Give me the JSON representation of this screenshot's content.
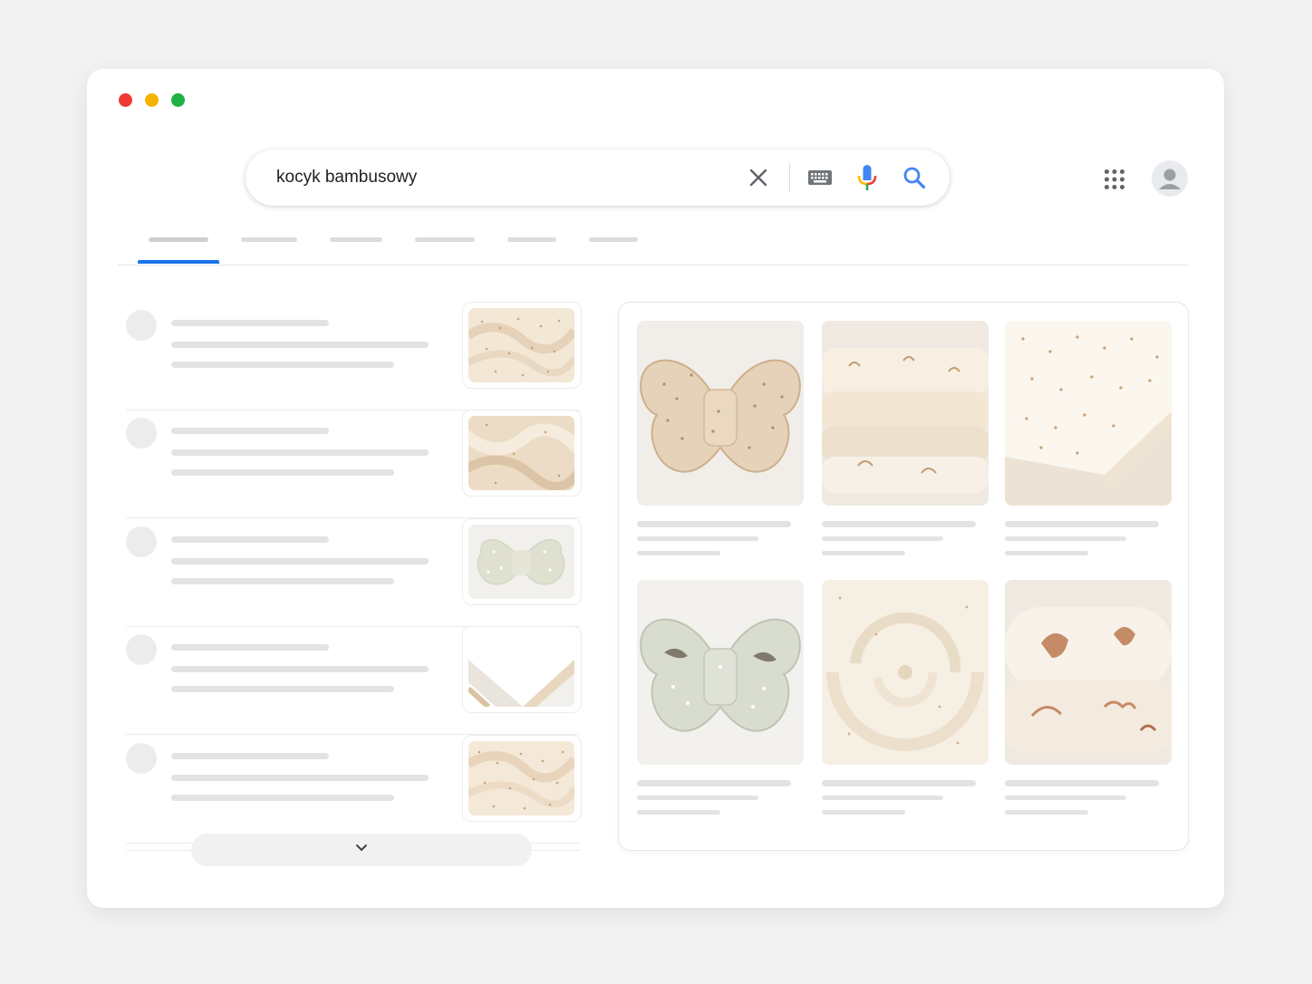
{
  "browser": {
    "traffic_lights": [
      "close",
      "minimize",
      "maximize"
    ],
    "traffic_colors": [
      "#ee3b34",
      "#f4b400",
      "#1fb141"
    ]
  },
  "search": {
    "query": "kocyk bambusowy",
    "icons": [
      "close-icon",
      "keyboard-icon",
      "mic-icon",
      "search-icon"
    ]
  },
  "header": {
    "icons": [
      "apps-grid-icon",
      "account-avatar-icon"
    ]
  },
  "tabs": {
    "count": 6,
    "active_index": 0,
    "accent_color": "#1a73e8"
  },
  "results": {
    "items": [
      {
        "thumbnail": "floral-blanket-swirl"
      },
      {
        "thumbnail": "beige-satin-fabric"
      },
      {
        "thumbnail": "butterfly-pillow-floral"
      },
      {
        "thumbnail": "white-fitted-sheet"
      },
      {
        "thumbnail": "floral-blanket-swirl"
      }
    ],
    "more_icon": "chevron-down-icon"
  },
  "image_panel": {
    "images": [
      {
        "subject": "butterfly-pillow-beige"
      },
      {
        "subject": "folded-blankets-stack"
      },
      {
        "subject": "fitted-sheet-floral"
      },
      {
        "subject": "butterfly-pillow-sage-birds"
      },
      {
        "subject": "fabric-swirl-cream"
      },
      {
        "subject": "rolled-blanket-animals"
      }
    ]
  }
}
